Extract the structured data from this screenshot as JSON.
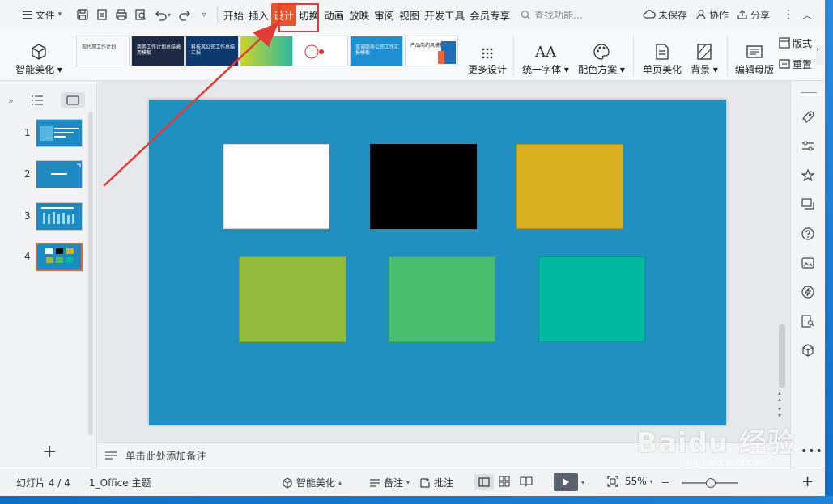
{
  "menubar": {
    "file_label": "文件",
    "tabs": [
      "开始",
      "插入",
      "设计",
      "切换",
      "动画",
      "放映",
      "审阅",
      "视图",
      "开发工具",
      "会员专享"
    ],
    "active_tab": "设计",
    "search_placeholder": "查找功能...",
    "unsaved": "未保存",
    "collab": "协作",
    "share": "分享"
  },
  "ribbon": {
    "smart_beautify": "智能美化",
    "more_design": "更多设计",
    "unify_font": "统一字体",
    "color_scheme": "配色方案",
    "single_page_beautify": "单页美化",
    "background": "背景",
    "edit_master": "编辑母版",
    "slide_size": "版式",
    "reset": "重置",
    "templates": [
      {
        "title": "现代风工作计划",
        "bg": "#ffffff",
        "fg": "#333333"
      },
      {
        "title": "商务工作计划总结通用模板",
        "bg": "#1e2a44",
        "fg": "#ffffff"
      },
      {
        "title": "科技风公司工作总结汇报",
        "bg": "#0d3a6e",
        "fg": "#ffffff"
      },
      {
        "title": "",
        "bg": "#2eb8a0",
        "fg": "#ffffff"
      },
      {
        "title": "",
        "bg": "#ffffff",
        "fg": "#d33"
      },
      {
        "title": "",
        "bg": "#1a6fb8",
        "fg": "#ffffff"
      },
      {
        "title": "蓝调商务公司工作汇报模板",
        "bg": "#1e8fd0",
        "fg": "#ffffff"
      },
      {
        "title": "产品简约风模板",
        "bg": "#ffffff",
        "fg": "#222222"
      }
    ]
  },
  "left_panel": {
    "slides": [
      {
        "num": "1"
      },
      {
        "num": "2"
      },
      {
        "num": "3"
      },
      {
        "num": "4"
      }
    ]
  },
  "slide": {
    "background": "#2090c0",
    "swatches": [
      {
        "name": "white",
        "color": "#ffffff"
      },
      {
        "name": "black",
        "color": "#000000"
      },
      {
        "name": "gold",
        "color": "#d6b01e"
      },
      {
        "name": "olive-green",
        "color": "#94bb3e"
      },
      {
        "name": "green",
        "color": "#48bf6e"
      },
      {
        "name": "teal",
        "color": "#00b7a0"
      }
    ]
  },
  "notes": {
    "placeholder": "单击此处添加备注"
  },
  "status": {
    "slide_counter": "幻灯片 4 / 4",
    "theme": "1_Office 主题",
    "smart_beautify": "智能美化",
    "notes": "备注",
    "comments": "批注",
    "zoom": "55%"
  },
  "watermark": {
    "text": "Baidu 经验",
    "sub": "jingyan.baidu.com"
  },
  "colors": {
    "accent": "#e8542c",
    "highlight_box": "#e23b34",
    "arrow": "#e23b34"
  }
}
